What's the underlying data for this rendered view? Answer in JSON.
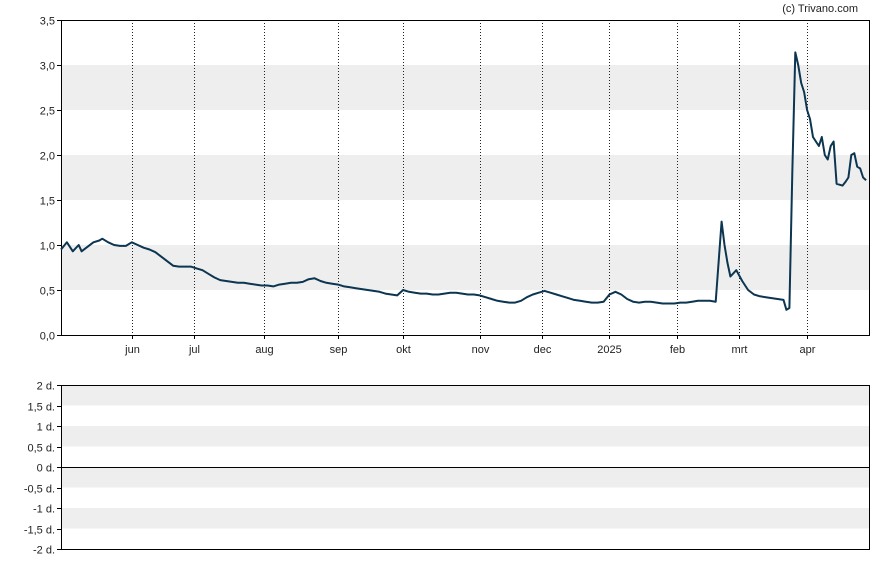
{
  "copyright": "(c) Trivano.com",
  "colors": {
    "line": "#0b3550",
    "band": "#eeeeee",
    "axis": "#000000",
    "grid": "#222222",
    "zero_line": "#000000"
  },
  "chart_data": [
    {
      "type": "line",
      "title": "",
      "xlabel": "",
      "ylabel": "",
      "ylim": [
        0,
        3.5
      ],
      "ytick_labels": [
        "0,0",
        "0,5",
        "1,0",
        "1,5",
        "2,0",
        "2,5",
        "3,0",
        "3,5"
      ],
      "xlim": [
        0,
        274
      ],
      "xtick_labels": [
        "jun",
        "jul",
        "aug",
        "sep",
        "okt",
        "nov",
        "dec",
        "2025",
        "feb",
        "mrt",
        "apr"
      ],
      "xtick_positions": [
        24,
        45,
        69,
        94,
        116,
        142,
        163,
        186,
        209,
        230,
        253
      ],
      "grid": "vertical dotted at month ticks, alternating horizontal bands",
      "series": [
        {
          "name": "",
          "points": [
            [
              0,
              0.95
            ],
            [
              2,
              1.03
            ],
            [
              4,
              0.93
            ],
            [
              6,
              1.0
            ],
            [
              7,
              0.93
            ],
            [
              9,
              0.98
            ],
            [
              11,
              1.03
            ],
            [
              13,
              1.05
            ],
            [
              14,
              1.07
            ],
            [
              16,
              1.03
            ],
            [
              18,
              1.0
            ],
            [
              20,
              0.99
            ],
            [
              22,
              0.99
            ],
            [
              24,
              1.03
            ],
            [
              26,
              1.0
            ],
            [
              28,
              0.97
            ],
            [
              30,
              0.95
            ],
            [
              32,
              0.92
            ],
            [
              34,
              0.87
            ],
            [
              36,
              0.82
            ],
            [
              38,
              0.77
            ],
            [
              40,
              0.76
            ],
            [
              42,
              0.76
            ],
            [
              44,
              0.76
            ],
            [
              46,
              0.74
            ],
            [
              48,
              0.72
            ],
            [
              50,
              0.68
            ],
            [
              52,
              0.64
            ],
            [
              54,
              0.61
            ],
            [
              56,
              0.6
            ],
            [
              58,
              0.59
            ],
            [
              60,
              0.58
            ],
            [
              62,
              0.58
            ],
            [
              64,
              0.57
            ],
            [
              66,
              0.56
            ],
            [
              68,
              0.55
            ],
            [
              70,
              0.55
            ],
            [
              72,
              0.54
            ],
            [
              74,
              0.56
            ],
            [
              76,
              0.57
            ],
            [
              78,
              0.58
            ],
            [
              80,
              0.58
            ],
            [
              82,
              0.59
            ],
            [
              84,
              0.62
            ],
            [
              86,
              0.63
            ],
            [
              88,
              0.6
            ],
            [
              90,
              0.58
            ],
            [
              92,
              0.57
            ],
            [
              94,
              0.56
            ],
            [
              96,
              0.54
            ],
            [
              98,
              0.53
            ],
            [
              100,
              0.52
            ],
            [
              102,
              0.51
            ],
            [
              104,
              0.5
            ],
            [
              106,
              0.49
            ],
            [
              108,
              0.48
            ],
            [
              110,
              0.46
            ],
            [
              112,
              0.45
            ],
            [
              114,
              0.44
            ],
            [
              116,
              0.5
            ],
            [
              118,
              0.48
            ],
            [
              120,
              0.47
            ],
            [
              122,
              0.46
            ],
            [
              124,
              0.46
            ],
            [
              126,
              0.45
            ],
            [
              128,
              0.45
            ],
            [
              130,
              0.46
            ],
            [
              132,
              0.47
            ],
            [
              134,
              0.47
            ],
            [
              136,
              0.46
            ],
            [
              138,
              0.45
            ],
            [
              140,
              0.45
            ],
            [
              142,
              0.44
            ],
            [
              144,
              0.42
            ],
            [
              146,
              0.4
            ],
            [
              148,
              0.38
            ],
            [
              150,
              0.37
            ],
            [
              152,
              0.36
            ],
            [
              154,
              0.36
            ],
            [
              156,
              0.38
            ],
            [
              158,
              0.42
            ],
            [
              160,
              0.45
            ],
            [
              162,
              0.47
            ],
            [
              164,
              0.49
            ],
            [
              166,
              0.47
            ],
            [
              168,
              0.45
            ],
            [
              170,
              0.43
            ],
            [
              172,
              0.41
            ],
            [
              174,
              0.39
            ],
            [
              176,
              0.38
            ],
            [
              178,
              0.37
            ],
            [
              180,
              0.36
            ],
            [
              182,
              0.36
            ],
            [
              184,
              0.37
            ],
            [
              186,
              0.45
            ],
            [
              188,
              0.48
            ],
            [
              190,
              0.45
            ],
            [
              192,
              0.4
            ],
            [
              194,
              0.37
            ],
            [
              196,
              0.36
            ],
            [
              198,
              0.37
            ],
            [
              200,
              0.37
            ],
            [
              202,
              0.36
            ],
            [
              204,
              0.35
            ],
            [
              206,
              0.35
            ],
            [
              208,
              0.35
            ],
            [
              210,
              0.36
            ],
            [
              212,
              0.36
            ],
            [
              214,
              0.37
            ],
            [
              216,
              0.38
            ],
            [
              218,
              0.38
            ],
            [
              220,
              0.38
            ],
            [
              222,
              0.37
            ],
            [
              224,
              1.26
            ],
            [
              225,
              1.0
            ],
            [
              226,
              0.8
            ],
            [
              227,
              0.65
            ],
            [
              229,
              0.72
            ],
            [
              231,
              0.6
            ],
            [
              233,
              0.5
            ],
            [
              235,
              0.45
            ],
            [
              237,
              0.43
            ],
            [
              239,
              0.42
            ],
            [
              241,
              0.41
            ],
            [
              243,
              0.4
            ],
            [
              245,
              0.39
            ],
            [
              246,
              0.28
            ],
            [
              247,
              0.3
            ],
            [
              248,
              1.8
            ],
            [
              249,
              3.14
            ],
            [
              250,
              3.0
            ],
            [
              251,
              2.8
            ],
            [
              252,
              2.7
            ],
            [
              253,
              2.5
            ],
            [
              254,
              2.4
            ],
            [
              255,
              2.2
            ],
            [
              256,
              2.15
            ],
            [
              257,
              2.1
            ],
            [
              258,
              2.2
            ],
            [
              259,
              2.0
            ],
            [
              260,
              1.95
            ],
            [
              261,
              2.1
            ],
            [
              262,
              2.15
            ],
            [
              263,
              1.68
            ],
            [
              264,
              1.67
            ],
            [
              265,
              1.66
            ],
            [
              266,
              1.7
            ],
            [
              267,
              1.75
            ],
            [
              268,
              2.0
            ],
            [
              269,
              2.02
            ],
            [
              270,
              1.87
            ],
            [
              271,
              1.85
            ],
            [
              272,
              1.75
            ],
            [
              273,
              1.72
            ]
          ]
        }
      ]
    },
    {
      "type": "line",
      "title": "",
      "xlabel": "",
      "ylabel": "",
      "ylim": [
        -2,
        2
      ],
      "ytick_labels": [
        "2 d.",
        "1,5 d.",
        "1 d.",
        "0,5 d.",
        "0 d.",
        "-0,5 d.",
        "-1 d.",
        "-1,5 d.",
        "-2 d."
      ],
      "grid": "alternating horizontal bands, solid zero line",
      "series": []
    }
  ]
}
